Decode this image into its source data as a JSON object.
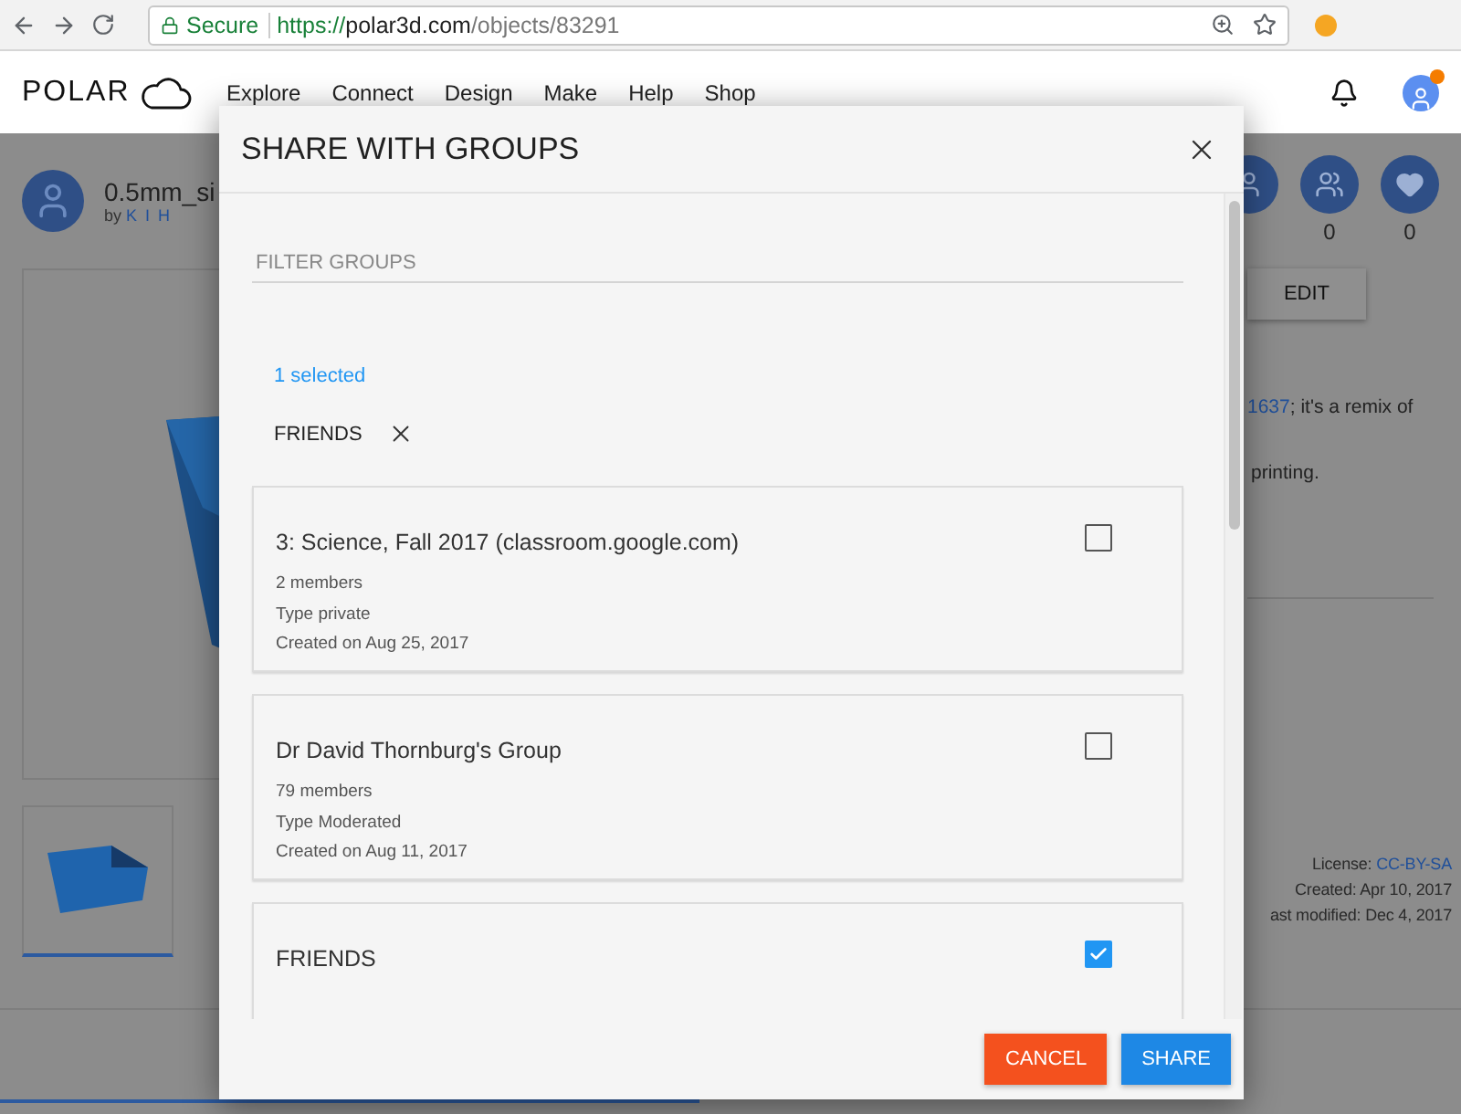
{
  "browser": {
    "secure_label": "Secure",
    "url_scheme": "https://",
    "url_host": "polar3d.com",
    "url_path": "/objects/83291"
  },
  "nav": {
    "logo": "POLAR",
    "links": [
      "Explore",
      "Connect",
      "Design",
      "Make",
      "Help",
      "Shop"
    ],
    "notification_dot": true
  },
  "object": {
    "title": "0.5mm_si",
    "by_label": "by",
    "author": "K I H",
    "counts": [
      "0",
      "0"
    ],
    "edit_button": "EDIT",
    "description_link": "1637",
    "description_rest": "; it's a remix of",
    "description_line2": "printing.",
    "license_label": "License:",
    "license": "CC-BY-SA",
    "created": "Created: Apr 10, 2017",
    "modified": "ast modified: Dec 4, 2017"
  },
  "dialog": {
    "title": "SHARE WITH GROUPS",
    "filter": {
      "placeholder": "FILTER GROUPS"
    },
    "selected_count": "1 selected",
    "chips": [
      "FRIENDS"
    ],
    "groups": [
      {
        "name": "3: Science, Fall 2017 (classroom.google.com)",
        "details": [
          "2 members",
          "Type private",
          "Created on Aug 25, 2017"
        ],
        "checked": false
      },
      {
        "name": "Dr David Thornburg's Group",
        "details": [
          "79 members",
          "Type Moderated",
          "Created on Aug 11, 2017"
        ],
        "checked": false
      },
      {
        "name": "FRIENDS",
        "checked": true
      }
    ],
    "buttons": [
      {
        "label": "CANCEL",
        "kind": "cancel"
      },
      {
        "label": "SHARE",
        "kind": "primary"
      }
    ]
  }
}
